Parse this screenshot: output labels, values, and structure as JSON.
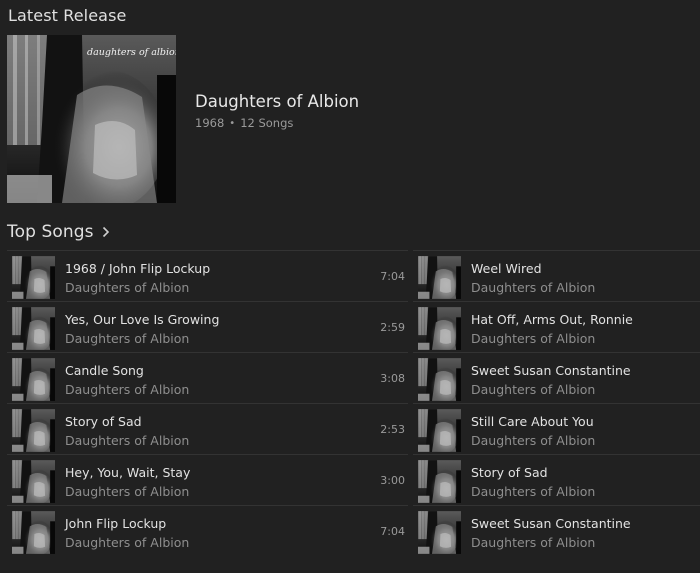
{
  "latest_release": {
    "heading": "Latest Release",
    "album": {
      "title": "Daughters of Albion",
      "cover_text": "daughters of albion",
      "year": "1968",
      "separator": "•",
      "song_count": "12 Songs"
    }
  },
  "top_songs": {
    "heading": "Top Songs",
    "left": [
      {
        "title": "1968 / John Flip Lockup",
        "artist": "Daughters of Albion",
        "duration": "7:04"
      },
      {
        "title": "Yes, Our Love Is Growing",
        "artist": "Daughters of Albion",
        "duration": "2:59"
      },
      {
        "title": "Candle Song",
        "artist": "Daughters of Albion",
        "duration": "3:08"
      },
      {
        "title": "Story of Sad",
        "artist": "Daughters of Albion",
        "duration": "2:53"
      },
      {
        "title": "Hey, You, Wait, Stay",
        "artist": "Daughters of Albion",
        "duration": "3:00"
      },
      {
        "title": "John Flip Lockup",
        "artist": "Daughters of Albion",
        "duration": "7:04"
      }
    ],
    "right": [
      {
        "title": "Weel Wired",
        "artist": "Daughters of Albion"
      },
      {
        "title": "Hat Off, Arms Out, Ronnie",
        "artist": "Daughters of Albion"
      },
      {
        "title": "Sweet Susan Constantine",
        "artist": "Daughters of Albion"
      },
      {
        "title": "Still Care About You",
        "artist": "Daughters of Albion"
      },
      {
        "title": "Story of Sad",
        "artist": "Daughters of Albion"
      },
      {
        "title": "Sweet Susan Constantine",
        "artist": "Daughters of Albion"
      }
    ]
  },
  "icons": {
    "chevron": "chevron-right-icon"
  },
  "colors": {
    "background": "#212121",
    "primary_text": "#e2e2e2",
    "secondary_text": "#8e8e8e",
    "divider": "#333333"
  }
}
